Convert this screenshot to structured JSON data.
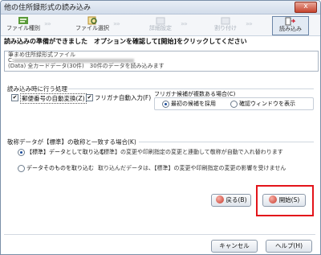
{
  "window": {
    "title": "他の住所録形式の読み込み",
    "close_label": "x"
  },
  "steps": [
    {
      "label": "ファイル種別",
      "icon": "file-type-icon",
      "state": "done"
    },
    {
      "label": "ファイル選択",
      "icon": "file-select-icon",
      "state": "done"
    },
    {
      "label": "詳細設定",
      "icon": "detail-settings-icon",
      "state": "disabled"
    },
    {
      "label": "割り付け",
      "icon": "assign-icon",
      "state": "disabled"
    },
    {
      "label": "読み込み",
      "icon": "import-icon",
      "state": "active"
    }
  ],
  "message": "読み込みの準備ができました　オプションを確認して[開始]をクリックしてください",
  "info": {
    "line1": "筆まめ住所録形式ファイル",
    "line2": "C:",
    "line3": "(Data) 全カードデータ(30件)　30件のデータを読み込みます"
  },
  "import_options": {
    "title": "読み込み時に行う処理",
    "postal_auto": {
      "label": "郵便番号の自動変換(Z)",
      "checked": true
    },
    "furigana_auto": {
      "label": "フリガナ自動入力(F)",
      "checked": true
    },
    "multiple_title": "フリガナ候補が複数ある場合(C)",
    "first_candidate": {
      "label": "最初の候補を採用",
      "selected": true
    },
    "confirm_window": {
      "label": "確認ウィンドウを表示",
      "selected": false
    }
  },
  "honorific": {
    "title": "敬称データが【標準】の敬称と一致する場合(K)",
    "option_standard": {
      "label": "【標準】データとして取り込む",
      "selected": true
    },
    "option_standard_note": "【標準】の変更や印刷指定の変更と連動して敬称が自動で入れ替わります",
    "option_raw": {
      "label": "データそのものを取り込む",
      "selected": false
    },
    "option_raw_note": "取り込んだデータは、【標準】の変更や印刷指定の変更の影響を受けません"
  },
  "buttons": {
    "back": "戻る(B)",
    "start": "開始(S)",
    "cancel": "キャンセル",
    "help": "ヘルプ(H)"
  },
  "colors": {
    "highlight": "#e3141a",
    "accent": "#1c4c9a"
  }
}
